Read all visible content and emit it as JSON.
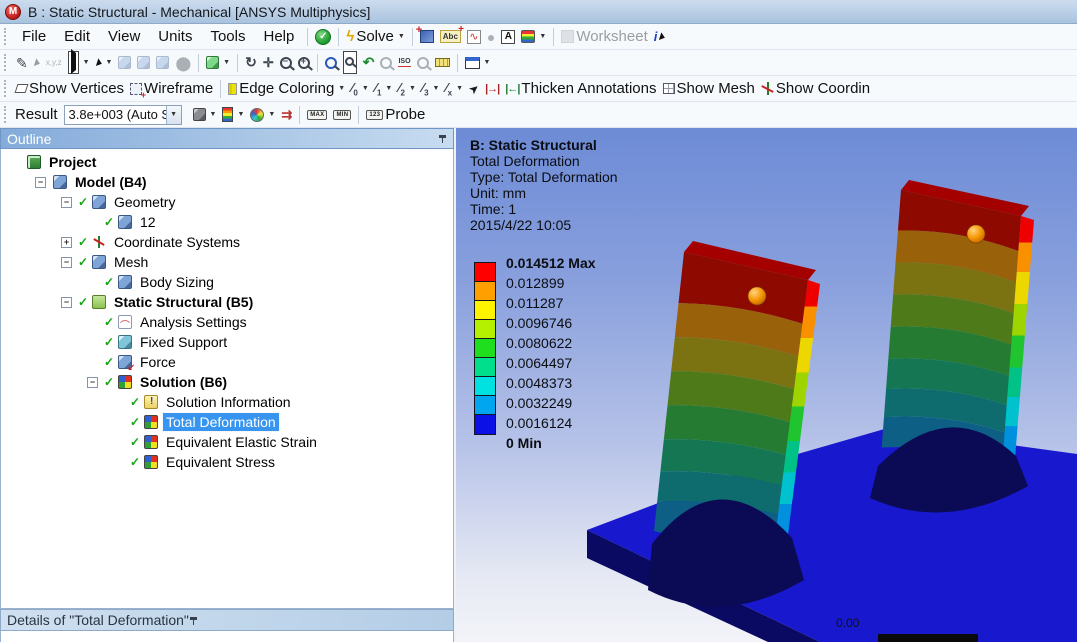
{
  "window": {
    "title": "B : Static Structural - Mechanical [ANSYS Multiphysics]",
    "logo_letter": "M"
  },
  "menus": [
    "File",
    "Edit",
    "View",
    "Units",
    "Tools",
    "Help"
  ],
  "toolbar_main": {
    "solve_label": "Solve",
    "worksheet_label": "Worksheet",
    "abc_icon_text": "Abc",
    "a_icon_text": "A",
    "chart_icon_text": "∿",
    "info_icon_text": "i"
  },
  "toolbar_graphics": {
    "show_vertices": "Show Vertices",
    "wireframe": "Wireframe",
    "edge_coloring": "Edge Coloring",
    "pen_labels": [
      "0",
      "1",
      "2",
      "3",
      "x"
    ],
    "thicken_annotations": "Thicken Annotations",
    "show_mesh": "Show Mesh",
    "show_coordinates": "Show Coordin",
    "dart_glyph": "➤",
    "thick1_glyph": "|→|",
    "thick2_glyph": "|←|"
  },
  "toolbar_result": {
    "result_label": "Result",
    "scale_value": "3.8e+003 (Auto S",
    "max_label": "MAX",
    "min_label": "MIN",
    "probe_badge": "123",
    "probe_label": "Probe"
  },
  "outline": {
    "header": "Outline",
    "tree": [
      {
        "label": "Project",
        "level": 0,
        "exp": null,
        "check": false,
        "icon": "ic-project",
        "bold": true,
        "selected": false,
        "name": "tree-item-project"
      },
      {
        "label": "Model (B4)",
        "level": 1,
        "exp": "minus",
        "check": false,
        "icon": "ic-cube",
        "bold": true,
        "selected": false,
        "name": "tree-item-model"
      },
      {
        "label": "Geometry",
        "level": 2,
        "exp": "minus",
        "check": true,
        "icon": "ic-cube",
        "bold": false,
        "selected": false,
        "name": "tree-item-geometry"
      },
      {
        "label": "12",
        "level": 3,
        "exp": null,
        "check": true,
        "icon": "ic-cube",
        "bold": false,
        "selected": false,
        "name": "tree-item-body-12"
      },
      {
        "label": "Coordinate Systems",
        "level": 2,
        "exp": "plus",
        "check": true,
        "icon": "ic-axes",
        "bold": false,
        "selected": false,
        "name": "tree-item-coordinate-systems"
      },
      {
        "label": "Mesh",
        "level": 2,
        "exp": "minus",
        "check": true,
        "icon": "ic-cube",
        "bold": false,
        "selected": false,
        "name": "tree-item-mesh"
      },
      {
        "label": "Body Sizing",
        "level": 3,
        "exp": null,
        "check": true,
        "icon": "ic-cube",
        "bold": false,
        "selected": false,
        "name": "tree-item-body-sizing"
      },
      {
        "label": "Static Structural (B5)",
        "level": 2,
        "exp": "minus",
        "check": true,
        "icon": "ic-folder",
        "bold": true,
        "selected": false,
        "name": "tree-item-static-structural"
      },
      {
        "label": "Analysis Settings",
        "level": 3,
        "exp": null,
        "check": true,
        "icon": "ic-analysis",
        "bold": false,
        "selected": false,
        "name": "tree-item-analysis-settings"
      },
      {
        "label": "Fixed Support",
        "level": 3,
        "exp": null,
        "check": true,
        "icon": "ic-support",
        "bold": false,
        "selected": false,
        "name": "tree-item-fixed-support"
      },
      {
        "label": "Force",
        "level": 3,
        "exp": null,
        "check": true,
        "icon": "ic-force",
        "bold": false,
        "selected": false,
        "name": "tree-item-force"
      },
      {
        "label": "Solution (B6)",
        "level": 3,
        "exp": "minus",
        "check": true,
        "icon": "ic-quad",
        "bold": true,
        "selected": false,
        "name": "tree-item-solution"
      },
      {
        "label": "Solution Information",
        "level": 4,
        "exp": null,
        "check": true,
        "icon": "ic-note",
        "bold": false,
        "selected": false,
        "name": "tree-item-solution-information"
      },
      {
        "label": "Total Deformation",
        "level": 4,
        "exp": null,
        "check": true,
        "icon": "ic-quad",
        "bold": false,
        "selected": true,
        "name": "tree-item-total-deformation"
      },
      {
        "label": "Equivalent Elastic Strain",
        "level": 4,
        "exp": null,
        "check": true,
        "icon": "ic-quad",
        "bold": false,
        "selected": false,
        "name": "tree-item-equivalent-elastic-strain"
      },
      {
        "label": "Equivalent Stress",
        "level": 4,
        "exp": null,
        "check": true,
        "icon": "ic-quad",
        "bold": false,
        "selected": false,
        "name": "tree-item-equivalent-stress"
      }
    ]
  },
  "details": {
    "header": "Details of \"Total Deformation\""
  },
  "viewport": {
    "annotation": [
      {
        "text": "B: Static Structural",
        "bold": true
      },
      {
        "text": "Total Deformation",
        "bold": false
      },
      {
        "text": "Type: Total Deformation",
        "bold": false
      },
      {
        "text": "Unit: mm",
        "bold": false
      },
      {
        "text": "Time: 1",
        "bold": false
      },
      {
        "text": "2015/4/22 10:05",
        "bold": false
      }
    ],
    "legend": {
      "labels": [
        {
          "text": "0.014512 Max",
          "bold": true
        },
        {
          "text": "0.012899",
          "bold": false
        },
        {
          "text": "0.011287",
          "bold": false
        },
        {
          "text": "0.0096746",
          "bold": false
        },
        {
          "text": "0.0080622",
          "bold": false
        },
        {
          "text": "0.0064497",
          "bold": false
        },
        {
          "text": "0.0048373",
          "bold": false
        },
        {
          "text": "0.0032249",
          "bold": false
        },
        {
          "text": "0.0016124",
          "bold": false
        },
        {
          "text": "0 Min",
          "bold": true
        }
      ],
      "band_colors": [
        "#ff0000",
        "#ffa000",
        "#fff400",
        "#b4f000",
        "#1ede1e",
        "#00e08c",
        "#00e2e2",
        "#00a6f0",
        "#0a10e6"
      ]
    },
    "ruler_label": "0.00"
  }
}
